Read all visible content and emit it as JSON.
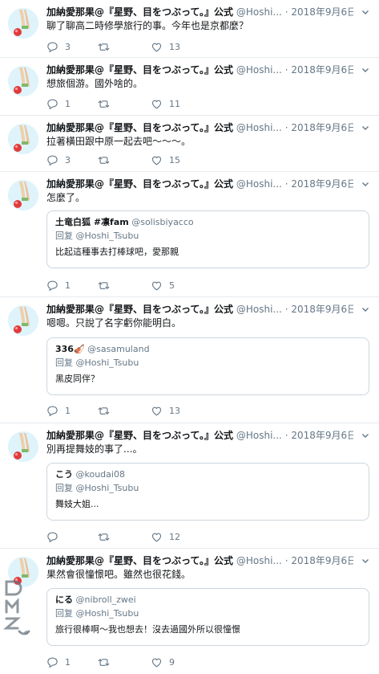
{
  "tweets": [
    {
      "author": "加納愛那果@『星野、目をつぶって。』公式",
      "handle": "@Hoshi...",
      "date": "· 2018年9月6日",
      "text": "聊了聊高二時修學旅行的事。今年也是京都麼？",
      "replies": "3",
      "retweets": "",
      "likes": "13"
    },
    {
      "author": "加納愛那果@『星野、目をつぶって。』公式",
      "handle": "@Hoshi...",
      "date": "· 2018年9月6日",
      "text": "想旅個游。國外啥的。",
      "replies": "1",
      "retweets": "",
      "likes": "11"
    },
    {
      "author": "加納愛那果@『星野、目をつぶって。』公式",
      "handle": "@Hoshi...",
      "date": "· 2018年9月6日",
      "text": "拉著橫田跟中原一起去吧～～～。",
      "replies": "3",
      "retweets": "",
      "likes": "15"
    },
    {
      "author": "加納愛那果@『星野、目をつぶって。』公式",
      "handle": "@Hoshi...",
      "date": "· 2018年9月6日",
      "text": "怎麼了。",
      "quote": {
        "name": "土竜白狐 #凛fam",
        "handle": "@solisbiyacco",
        "reply_prefix": "回复",
        "reply_to": "@Hoshi_Tsubu",
        "text": "比起這種事去打棒球吧，愛那親"
      },
      "replies": "1",
      "retweets": "",
      "likes": "5"
    },
    {
      "author": "加納愛那果@『星野、目をつぶって。』公式",
      "handle": "@Hoshi...",
      "date": "· 2018年9月6日",
      "text": "嗯嗯。只說了名字虧你能明白。",
      "quote": {
        "name": "336🎻",
        "handle": "@sasamuland",
        "reply_prefix": "回复",
        "reply_to": "@Hoshi_Tsubu",
        "text": "黑皮同伴？"
      },
      "replies": "1",
      "retweets": "",
      "likes": "13"
    },
    {
      "author": "加納愛那果@『星野、目をつぶって。』公式",
      "handle": "@Hoshi...",
      "date": "· 2018年9月6日",
      "text": "別再提舞妓的事了...。",
      "quote": {
        "name": "こう",
        "handle": "@koudai08",
        "reply_prefix": "回复",
        "reply_to": "@Hoshi_Tsubu",
        "text": "舞妓大姐..."
      },
      "replies": "",
      "retweets": "",
      "likes": "12"
    },
    {
      "author": "加納愛那果@『星野、目をつぶって。』公式",
      "handle": "@Hoshi...",
      "date": "· 2018年9月6日",
      "text": "果然會很憧憬吧。雖然也很花錢。",
      "quote": {
        "name": "にる",
        "handle": "@nibroll_zwei",
        "reply_prefix": "回复",
        "reply_to": "@Hoshi_Tsubu",
        "text": "旅行很棒啊～我也想去！沒去過國外所以很憧憬"
      },
      "replies": "1",
      "retweets": "",
      "likes": "9"
    }
  ],
  "watermark": "DMZJ",
  "colors": {
    "muted": "#657786",
    "border": "#e6ecf0",
    "quote_border": "#ccd6dd"
  }
}
